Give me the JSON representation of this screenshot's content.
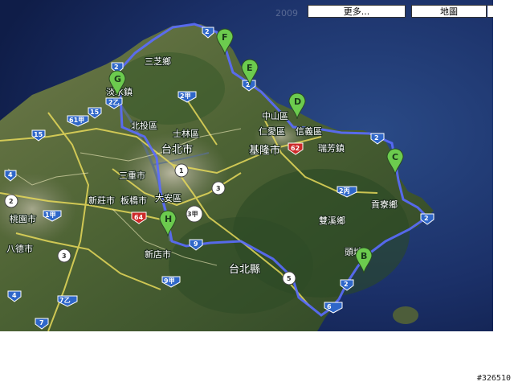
{
  "controls": {
    "more_label": "更多...",
    "map_label": "地圖"
  },
  "watermark": "2009",
  "image_id": "#326510",
  "places": [
    {
      "key": "sanzhi",
      "text": "三芝鄉"
    },
    {
      "key": "danshui",
      "text": "淡水鎮"
    },
    {
      "key": "beitou",
      "text": "北投區"
    },
    {
      "key": "shilin",
      "text": "士林區"
    },
    {
      "key": "taipei",
      "text": "台北市"
    },
    {
      "key": "sanchong",
      "text": "三重市"
    },
    {
      "key": "xinzhuang",
      "text": "新莊市"
    },
    {
      "key": "banqiao",
      "text": "板橋市"
    },
    {
      "key": "daan",
      "text": "大安區"
    },
    {
      "key": "taoyuan",
      "text": "桃園市"
    },
    {
      "key": "bade",
      "text": "八德市"
    },
    {
      "key": "xindian",
      "text": "新店市"
    },
    {
      "key": "taipeixian",
      "text": "台北縣"
    },
    {
      "key": "zhongshan",
      "text": "中山區"
    },
    {
      "key": "renai",
      "text": "仁愛區"
    },
    {
      "key": "xinyi",
      "text": "信義區"
    },
    {
      "key": "keelung",
      "text": "基隆市"
    },
    {
      "key": "ruifang",
      "text": "瑞芳鎮"
    },
    {
      "key": "gongliao",
      "text": "貢寮鄉"
    },
    {
      "key": "shuangxi",
      "text": "雙溪鄉"
    },
    {
      "key": "toucheng",
      "text": "頭城"
    }
  ],
  "markers": [
    "F",
    "E",
    "G",
    "D",
    "C",
    "H",
    "B"
  ],
  "shields": [
    "2",
    "2",
    "2乙",
    "2甲",
    "61甲",
    "15",
    "15",
    "4",
    "2",
    "1甲",
    "64",
    "1",
    "3",
    "3甲",
    "9",
    "9甲",
    "5",
    "62",
    "2",
    "2丙",
    "2",
    "2",
    "2",
    "4",
    "7乙",
    "7",
    "3",
    "6"
  ]
}
